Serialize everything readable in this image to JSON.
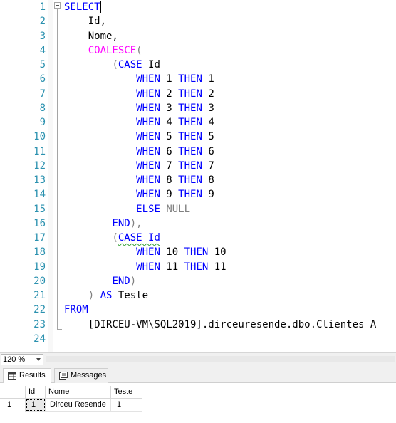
{
  "editor": {
    "line_numbers": [
      "1",
      "2",
      "3",
      "4",
      "5",
      "6",
      "7",
      "8",
      "9",
      "10",
      "11",
      "12",
      "13",
      "14",
      "15",
      "16",
      "17",
      "18",
      "19",
      "20",
      "21",
      "22",
      "23",
      "24"
    ],
    "lines": [
      [
        {
          "t": "SELECT",
          "c": "kw"
        }
      ],
      [
        {
          "t": "    Id,",
          "c": ""
        }
      ],
      [
        {
          "t": "    Nome,",
          "c": ""
        }
      ],
      [
        {
          "t": "    ",
          "c": ""
        },
        {
          "t": "COALESCE",
          "c": "fn"
        },
        {
          "t": "(",
          "c": "gr"
        }
      ],
      [
        {
          "t": "        ",
          "c": ""
        },
        {
          "t": "(",
          "c": "gr"
        },
        {
          "t": "CASE",
          "c": "kw"
        },
        {
          "t": " Id",
          "c": ""
        }
      ],
      [
        {
          "t": "            ",
          "c": ""
        },
        {
          "t": "WHEN",
          "c": "kw"
        },
        {
          "t": " 1 ",
          "c": ""
        },
        {
          "t": "THEN",
          "c": "kw"
        },
        {
          "t": " 1",
          "c": ""
        }
      ],
      [
        {
          "t": "            ",
          "c": ""
        },
        {
          "t": "WHEN",
          "c": "kw"
        },
        {
          "t": " 2 ",
          "c": ""
        },
        {
          "t": "THEN",
          "c": "kw"
        },
        {
          "t": " 2",
          "c": ""
        }
      ],
      [
        {
          "t": "            ",
          "c": ""
        },
        {
          "t": "WHEN",
          "c": "kw"
        },
        {
          "t": " 3 ",
          "c": ""
        },
        {
          "t": "THEN",
          "c": "kw"
        },
        {
          "t": " 3",
          "c": ""
        }
      ],
      [
        {
          "t": "            ",
          "c": ""
        },
        {
          "t": "WHEN",
          "c": "kw"
        },
        {
          "t": " 4 ",
          "c": ""
        },
        {
          "t": "THEN",
          "c": "kw"
        },
        {
          "t": " 4",
          "c": ""
        }
      ],
      [
        {
          "t": "            ",
          "c": ""
        },
        {
          "t": "WHEN",
          "c": "kw"
        },
        {
          "t": " 5 ",
          "c": ""
        },
        {
          "t": "THEN",
          "c": "kw"
        },
        {
          "t": " 5",
          "c": ""
        }
      ],
      [
        {
          "t": "            ",
          "c": ""
        },
        {
          "t": "WHEN",
          "c": "kw"
        },
        {
          "t": " 6 ",
          "c": ""
        },
        {
          "t": "THEN",
          "c": "kw"
        },
        {
          "t": " 6",
          "c": ""
        }
      ],
      [
        {
          "t": "            ",
          "c": ""
        },
        {
          "t": "WHEN",
          "c": "kw"
        },
        {
          "t": " 7 ",
          "c": ""
        },
        {
          "t": "THEN",
          "c": "kw"
        },
        {
          "t": " 7",
          "c": ""
        }
      ],
      [
        {
          "t": "            ",
          "c": ""
        },
        {
          "t": "WHEN",
          "c": "kw"
        },
        {
          "t": " 8 ",
          "c": ""
        },
        {
          "t": "THEN",
          "c": "kw"
        },
        {
          "t": " 8",
          "c": ""
        }
      ],
      [
        {
          "t": "            ",
          "c": ""
        },
        {
          "t": "WHEN",
          "c": "kw"
        },
        {
          "t": " 9 ",
          "c": ""
        },
        {
          "t": "THEN",
          "c": "kw"
        },
        {
          "t": " 9",
          "c": ""
        }
      ],
      [
        {
          "t": "            ",
          "c": ""
        },
        {
          "t": "ELSE",
          "c": "kw"
        },
        {
          "t": " ",
          "c": ""
        },
        {
          "t": "NULL",
          "c": "gr"
        }
      ],
      [
        {
          "t": "        ",
          "c": ""
        },
        {
          "t": "END",
          "c": "kw"
        },
        {
          "t": "),",
          "c": "gr"
        }
      ],
      [
        {
          "t": "        ",
          "c": ""
        },
        {
          "t": "(",
          "c": "gr"
        },
        {
          "t": "CASE Id",
          "c": "kw sq"
        }
      ],
      [
        {
          "t": "            ",
          "c": ""
        },
        {
          "t": "WHEN",
          "c": "kw"
        },
        {
          "t": " 10 ",
          "c": ""
        },
        {
          "t": "THEN",
          "c": "kw"
        },
        {
          "t": " 10",
          "c": ""
        }
      ],
      [
        {
          "t": "            ",
          "c": ""
        },
        {
          "t": "WHEN",
          "c": "kw"
        },
        {
          "t": " 11 ",
          "c": ""
        },
        {
          "t": "THEN",
          "c": "kw"
        },
        {
          "t": " 11",
          "c": ""
        }
      ],
      [
        {
          "t": "        ",
          "c": ""
        },
        {
          "t": "END",
          "c": "kw"
        },
        {
          "t": ")",
          "c": "gr"
        }
      ],
      [
        {
          "t": "    ",
          "c": ""
        },
        {
          "t": ")",
          "c": "gr"
        },
        {
          "t": " ",
          "c": ""
        },
        {
          "t": "AS",
          "c": "kw"
        },
        {
          "t": " Teste",
          "c": ""
        }
      ],
      [
        {
          "t": "FROM",
          "c": "kw"
        }
      ],
      [
        {
          "t": "    [DIRCEU-VM\\SQL2019].dirceuresende.dbo.Clientes A",
          "c": ""
        }
      ],
      [
        {
          "t": "",
          "c": ""
        }
      ]
    ]
  },
  "status_bar": {
    "zoom_value": "120 %"
  },
  "results": {
    "tabs": [
      {
        "label": "Results",
        "icon": "grid-icon",
        "active": true
      },
      {
        "label": "Messages",
        "icon": "messages-icon",
        "active": false
      }
    ],
    "columns": [
      "Id",
      "Nome",
      "Teste"
    ],
    "rows": [
      {
        "row_number": "1",
        "cells": [
          "1",
          "Dirceu Resende",
          "1"
        ]
      }
    ]
  },
  "colors": {
    "keyword": "#0000ff",
    "function": "#ff00ff",
    "operator": "#808080",
    "line_number": "#2b91af",
    "squiggle": "#2e9e2e"
  }
}
